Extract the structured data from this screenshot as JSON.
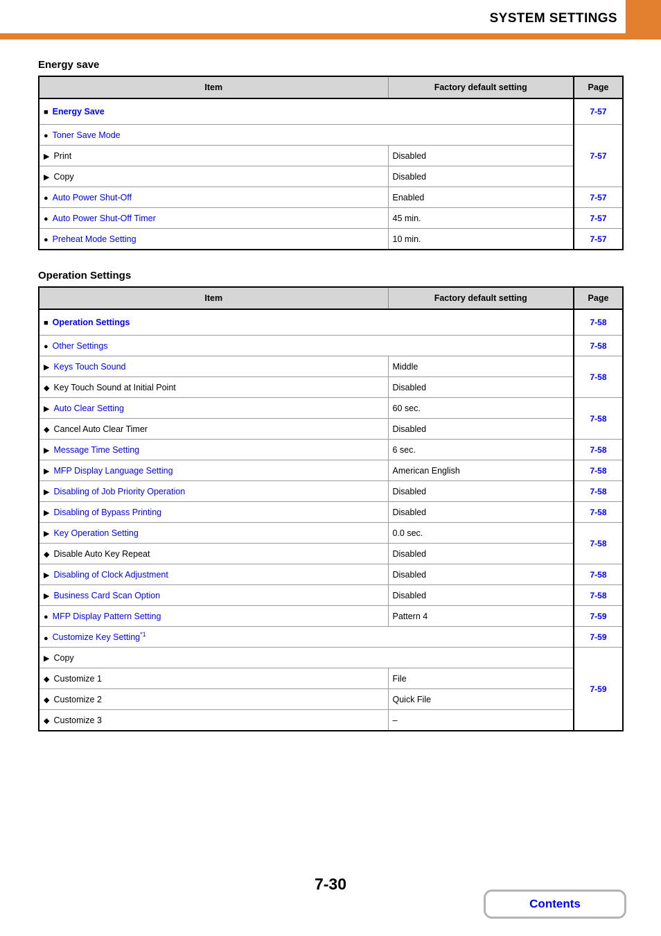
{
  "header": {
    "title": "SYSTEM SETTINGS",
    "accent_color": "#e2802f"
  },
  "link_color": "#0000ff",
  "columns": {
    "item": "Item",
    "factory": "Factory default setting",
    "page": "Page"
  },
  "sections": [
    {
      "title": "Energy save",
      "rows": [
        {
          "level": 1,
          "bullet": "square",
          "label": "Energy Save",
          "factory": null,
          "page": "7-57"
        },
        {
          "level": 2,
          "bullet": "circle",
          "label": "Toner Save Mode",
          "factory": null,
          "page": "7-57"
        },
        {
          "level": 3,
          "bullet": "triangle",
          "label": "Print",
          "factory": "Disabled",
          "page": null
        },
        {
          "level": 3,
          "bullet": "triangle",
          "label": "Copy",
          "factory": "Disabled",
          "page": null
        },
        {
          "level": 2,
          "bullet": "circle",
          "label": "Auto Power Shut-Off",
          "factory": "Enabled",
          "page": "7-57"
        },
        {
          "level": 2,
          "bullet": "circle",
          "label": "Auto Power Shut-Off Timer",
          "factory": "45 min.",
          "page": "7-57"
        },
        {
          "level": 2,
          "bullet": "circle",
          "label": "Preheat Mode Setting",
          "factory": "10 min.",
          "page": "7-57"
        }
      ]
    },
    {
      "title": "Operation Settings",
      "rows": [
        {
          "level": 1,
          "bullet": "square",
          "label": "Operation Settings",
          "factory": null,
          "page": "7-58"
        },
        {
          "level": 2,
          "bullet": "circle",
          "label": "Other Settings",
          "factory": null,
          "page": "7-58"
        },
        {
          "level": 3,
          "bullet": "triangle",
          "label": "Keys Touch Sound",
          "factory": "Middle",
          "page": "7-58"
        },
        {
          "level": 4,
          "bullet": "diamond",
          "label": "Key Touch Sound at Initial Point",
          "factory": "Disabled",
          "page": null
        },
        {
          "level": 3,
          "bullet": "triangle",
          "label": "Auto Clear Setting",
          "factory": "60 sec.",
          "page": "7-58"
        },
        {
          "level": 4,
          "bullet": "diamond",
          "label": "Cancel Auto Clear Timer",
          "factory": "Disabled",
          "page": null
        },
        {
          "level": 3,
          "bullet": "triangle",
          "label": "Message Time Setting",
          "factory": "6 sec.",
          "page": "7-58"
        },
        {
          "level": 3,
          "bullet": "triangle",
          "label": "MFP Display Language Setting",
          "factory": "American English",
          "page": "7-58"
        },
        {
          "level": 3,
          "bullet": "triangle",
          "label": "Disabling of Job Priority Operation",
          "factory": "Disabled",
          "page": "7-58"
        },
        {
          "level": 3,
          "bullet": "triangle",
          "label": "Disabling of Bypass Printing",
          "factory": "Disabled",
          "page": "7-58"
        },
        {
          "level": 3,
          "bullet": "triangle",
          "label": "Key Operation Setting",
          "factory": "0.0 sec.",
          "page": "7-58"
        },
        {
          "level": 4,
          "bullet": "diamond",
          "label": "Disable Auto Key Repeat",
          "factory": "Disabled",
          "page": null
        },
        {
          "level": 3,
          "bullet": "triangle",
          "label": "Disabling of Clock Adjustment",
          "factory": "Disabled",
          "page": "7-58"
        },
        {
          "level": 3,
          "bullet": "triangle",
          "label": "Business Card Scan Option",
          "factory": "Disabled",
          "page": "7-58"
        },
        {
          "level": 2,
          "bullet": "circle",
          "label": "MFP Display Pattern Setting",
          "factory": "Pattern 4",
          "page": "7-59"
        },
        {
          "level": 2,
          "bullet": "circle",
          "label": "Customize Key Setting",
          "footnote": "*1",
          "factory": null,
          "page": "7-59"
        },
        {
          "level": 3,
          "bullet": "triangle",
          "label": "Copy",
          "factory": null,
          "page": "7-59"
        },
        {
          "level": 4,
          "bullet": "diamond",
          "label": "Customize 1",
          "factory": "File",
          "page": null
        },
        {
          "level": 4,
          "bullet": "diamond",
          "label": "Customize 2",
          "factory": "Quick File",
          "page": null
        },
        {
          "level": 4,
          "bullet": "diamond",
          "label": "Customize 3",
          "factory": "–",
          "page": null
        }
      ]
    }
  ],
  "footer": {
    "page_number": "7-30",
    "contents_label": "Contents"
  }
}
